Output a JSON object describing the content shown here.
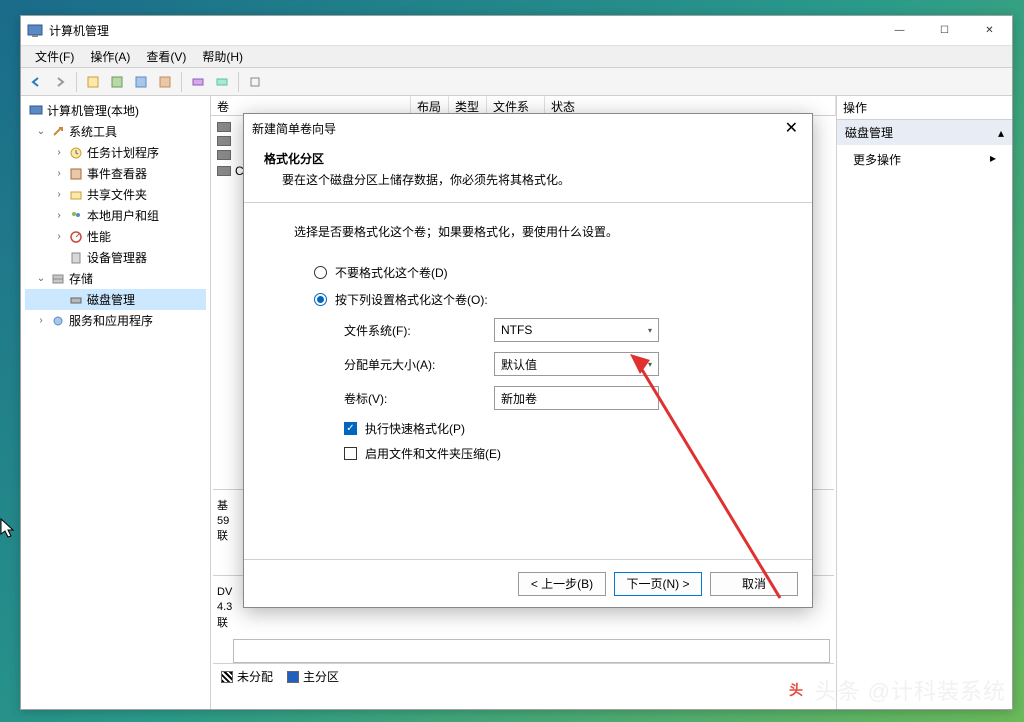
{
  "window": {
    "title": "计算机管理",
    "controls": {
      "minimize": "—",
      "maximize": "☐",
      "close": "✕"
    }
  },
  "menu": {
    "file": "文件(F)",
    "action": "操作(A)",
    "view": "查看(V)",
    "help": "帮助(H)"
  },
  "tree": {
    "root": "计算机管理(本地)",
    "system_tools": "系统工具",
    "task_scheduler": "任务计划程序",
    "event_viewer": "事件查看器",
    "shared_folders": "共享文件夹",
    "local_users": "本地用户和组",
    "performance": "性能",
    "device_manager": "设备管理器",
    "storage": "存储",
    "disk_management": "磁盘管理",
    "services_apps": "服务和应用程序"
  },
  "list_headers": {
    "volume": "卷",
    "layout": "布局",
    "type": "类型",
    "filesystem": "文件系统",
    "status": "状态"
  },
  "disk_section": {
    "basic": "基",
    "size": "59",
    "online": "联",
    "dvd_prefix": "DV",
    "dvd_size": "4.3",
    "dvd_status": "联"
  },
  "legend": {
    "unallocated": "未分配",
    "primary": "主分区"
  },
  "actions_panel": {
    "title": "操作",
    "group": "磁盘管理",
    "more": "更多操作"
  },
  "wizard": {
    "title": "新建简单卷向导",
    "close_x": "✕",
    "heading": "格式化分区",
    "subheading": "要在这个磁盘分区上储存数据，你必须先将其格式化。",
    "instruction": "选择是否要格式化这个卷；如果要格式化，要使用什么设置。",
    "radio_no_format": "不要格式化这个卷(D)",
    "radio_format": "按下列设置格式化这个卷(O):",
    "label_filesystem": "文件系统(F):",
    "value_filesystem": "NTFS",
    "label_alloc": "分配单元大小(A):",
    "value_alloc": "默认值",
    "label_volname": "卷标(V):",
    "value_volname": "新加卷",
    "check_quick": "执行快速格式化(P)",
    "check_compress": "启用文件和文件夹压缩(E)",
    "btn_back": "< 上一步(B)",
    "btn_next": "下一页(N) >",
    "btn_cancel": "取消"
  },
  "watermark": "头条 @计科装系统"
}
